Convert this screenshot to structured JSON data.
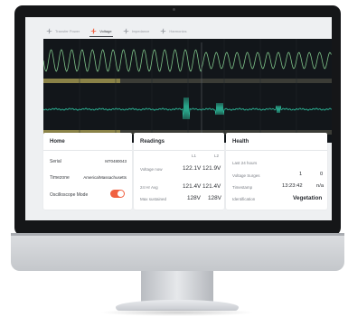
{
  "tabs": [
    {
      "label": "Transfer Power",
      "icon": "lightning-icon",
      "active": false
    },
    {
      "label": "Voltage",
      "icon": "lightning-icon",
      "active": true
    },
    {
      "label": "Impedance",
      "icon": "lightning-icon",
      "active": false
    },
    {
      "label": "Harmonics",
      "icon": "lightning-icon",
      "active": false
    }
  ],
  "colors": {
    "accent": "#f06040",
    "waveform": "#7fc48a",
    "trace": "#2fc9a6",
    "scope_bg": "#12161a",
    "band": "#8a8247"
  },
  "home": {
    "title": "Home",
    "serial_label": "Serial",
    "serial_value": "M70480043",
    "timezone_label": "Timezone",
    "timezone_value": "America/Massachusetts",
    "oscilloscope_label": "Oscilloscope Mode",
    "oscilloscope_on": true
  },
  "readings": {
    "title": "Readings",
    "col1": "L1",
    "col2": "L2",
    "rows": [
      {
        "label": "Voltage now",
        "l1": "122.1V",
        "l2": "121.9V"
      },
      {
        "label": "24 Hr Avg",
        "l1": "121.4V",
        "l2": "121.4V"
      },
      {
        "label": "Max sustained",
        "l1": "128V",
        "l2": "128V"
      }
    ]
  },
  "health": {
    "title": "Health",
    "subtitle": "Last 24 hours",
    "rows": [
      {
        "label": "Voltage Surges",
        "v1": "1",
        "v2": "0"
      },
      {
        "label": "Timestamp",
        "v1": "13:23:42",
        "v2": "n/a"
      },
      {
        "label": "Identification",
        "v1": "Vegetation",
        "v2": ""
      }
    ]
  }
}
